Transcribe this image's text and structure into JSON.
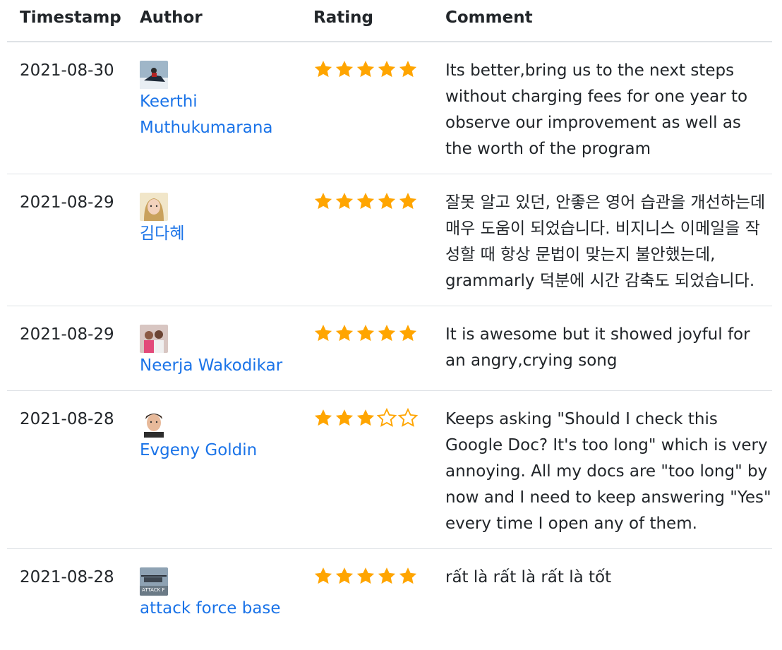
{
  "headers": {
    "timestamp": "Timestamp",
    "author": "Author",
    "rating": "Rating",
    "comment": "Comment"
  },
  "colors": {
    "star": "#ffa500",
    "link": "#1a73e8",
    "border": "#dee2e6"
  },
  "rows": [
    {
      "timestamp": "2021-08-30",
      "author": "Keerthi Muthukumarana",
      "avatar_icon": "avatar-snowmobile-photo",
      "rating": 5,
      "comment": "Its better,bring us to the next steps without charging fees for one year to observe our improvement as well as the worth of the program"
    },
    {
      "timestamp": "2021-08-29",
      "author": "김다혜",
      "avatar_icon": "avatar-woman-portrait-photo",
      "rating": 5,
      "comment": "잘못 알고 있던, 안좋은 영어 습관을 개선하는데 매우 도움이 되었습니다. 비지니스 이메일을 작성할 때 항상 문법이 맞는지 불안했는데, grammarly 덕분에 시간 감축도 되었습니다."
    },
    {
      "timestamp": "2021-08-29",
      "author": "Neerja Wakodikar",
      "avatar_icon": "avatar-two-people-photo",
      "rating": 5,
      "comment": "It is awesome but it showed joyful for an angry,crying song"
    },
    {
      "timestamp": "2021-08-28",
      "author": "Evgeny Goldin",
      "avatar_icon": "avatar-man-portrait-photo",
      "rating": 3,
      "comment": "Keeps asking \"Should I check this Google Doc? It's too long\" which is very annoying. All my docs are \"too long\" by now and I need to keep answering \"Yes\" every time I open any of them."
    },
    {
      "timestamp": "2021-08-28",
      "author": "attack force base",
      "avatar_icon": "avatar-helicopter-photo",
      "avatar_text": "ATTACK F",
      "rating": 5,
      "comment": "rất là rất là rất là tốt"
    }
  ]
}
